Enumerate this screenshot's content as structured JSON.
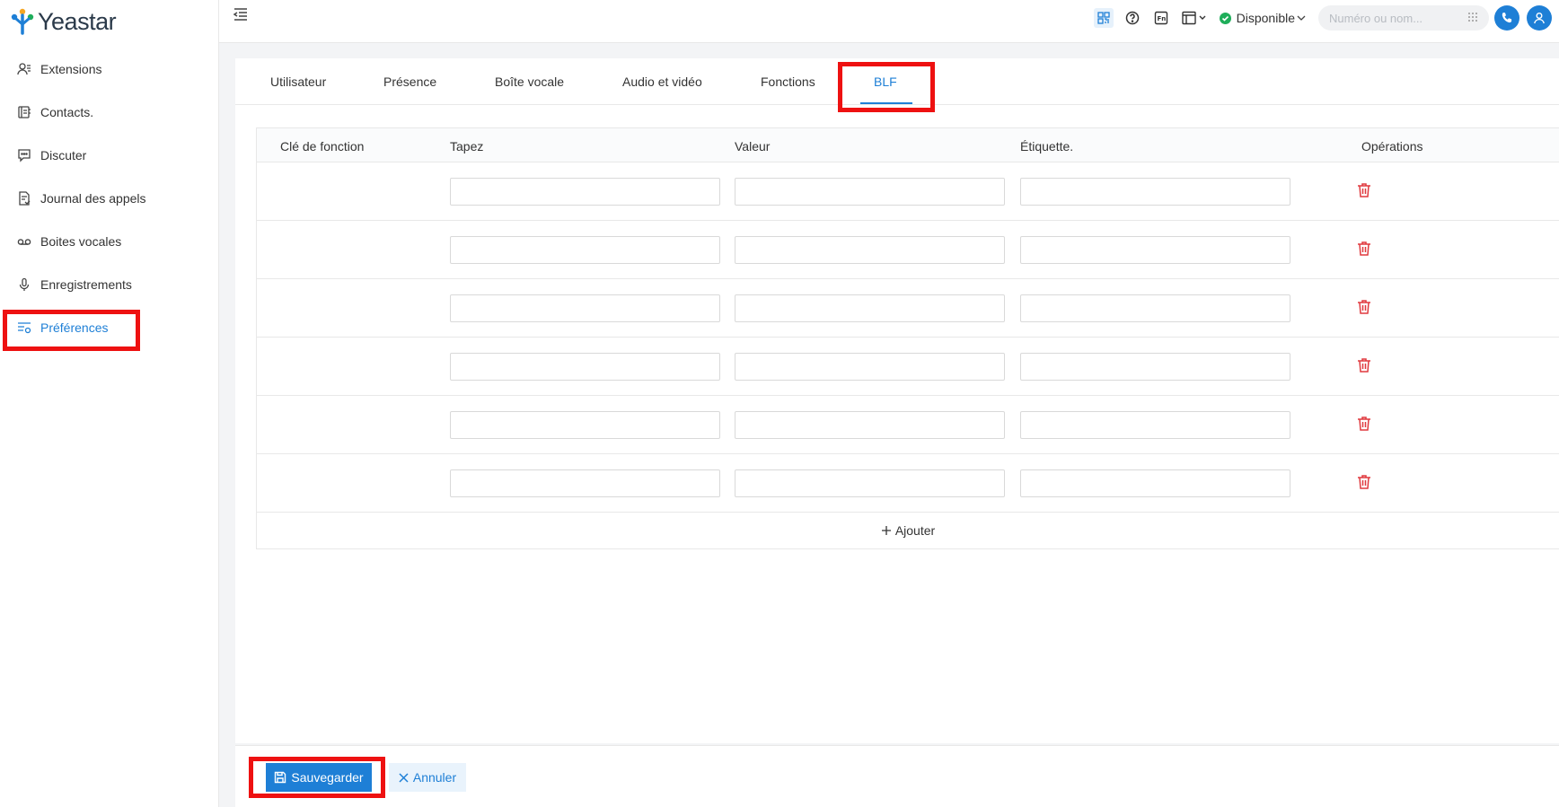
{
  "app": {
    "name": "Yeastar"
  },
  "sidebar": {
    "items": [
      {
        "label": "Extensions",
        "icon": "user-list-icon"
      },
      {
        "label": "Contacts.",
        "icon": "contacts-book-icon"
      },
      {
        "label": "Discuter",
        "icon": "chat-icon"
      },
      {
        "label": "Journal des appels",
        "icon": "call-log-icon"
      },
      {
        "label": "Boites vocales",
        "icon": "voicemail-icon"
      },
      {
        "label": "Enregistrements",
        "icon": "microphone-icon"
      },
      {
        "label": "Préférences",
        "icon": "preferences-icon",
        "active": true
      }
    ]
  },
  "topbar": {
    "status": "Disponible",
    "search_placeholder": "Numéro ou nom..."
  },
  "tabs": [
    {
      "label": "Utilisateur"
    },
    {
      "label": "Présence"
    },
    {
      "label": "Boîte vocale"
    },
    {
      "label": "Audio et vidéo"
    },
    {
      "label": "Fonctions"
    },
    {
      "label": "BLF",
      "active": true
    }
  ],
  "table": {
    "headers": {
      "key": "Clé de fonction",
      "type": "Tapez",
      "value": "Valeur",
      "label": "Étiquette.",
      "ops": "Opérations"
    },
    "rows": [
      {
        "key": "",
        "type": "",
        "value": "",
        "label": ""
      },
      {
        "key": "",
        "type": "",
        "value": "",
        "label": ""
      },
      {
        "key": "",
        "type": "",
        "value": "",
        "label": ""
      },
      {
        "key": "",
        "type": "",
        "value": "",
        "label": ""
      },
      {
        "key": "",
        "type": "",
        "value": "",
        "label": ""
      },
      {
        "key": "",
        "type": "",
        "value": "",
        "label": ""
      }
    ],
    "add_label": "Ajouter"
  },
  "footer": {
    "save_label": "Sauvegarder",
    "cancel_label": "Annuler"
  },
  "colors": {
    "accent": "#1e7fd6",
    "danger": "#e0393e",
    "success": "#1fae5a",
    "highlight": "#ee1111"
  }
}
